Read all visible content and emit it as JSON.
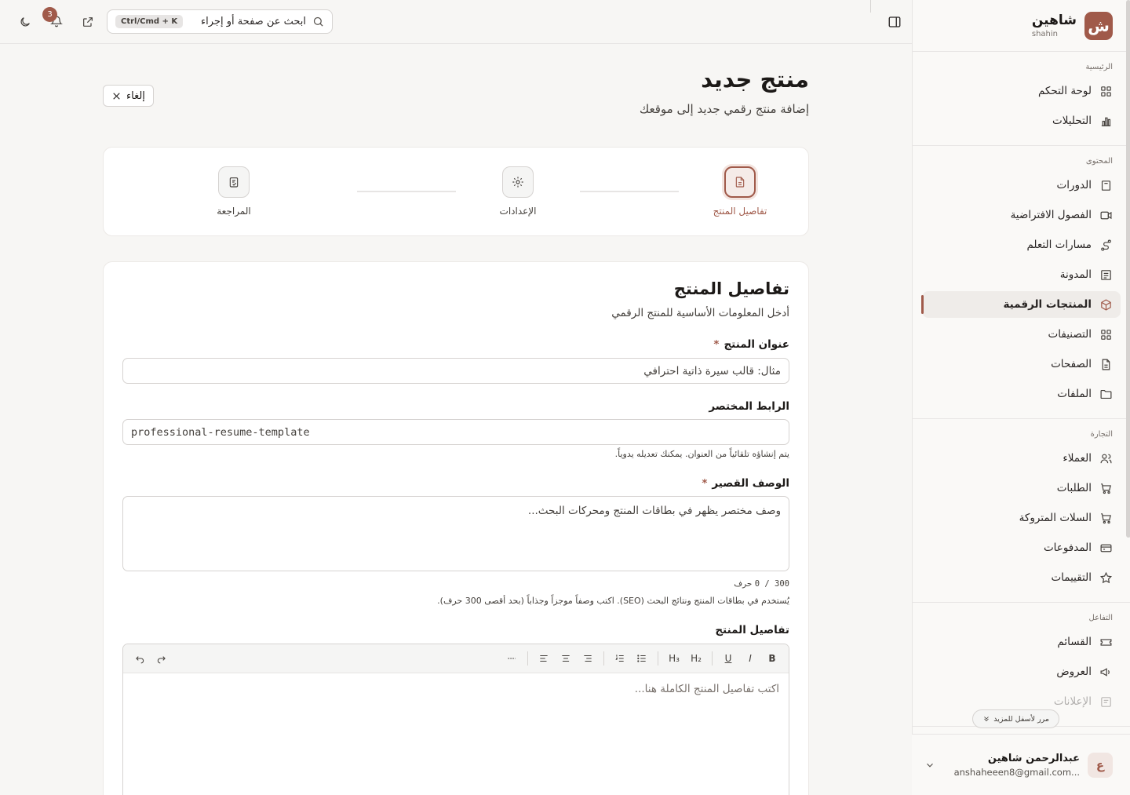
{
  "brand": {
    "logo_letter": "ش",
    "name": "شاهين",
    "sub": "shahin"
  },
  "sidebar": {
    "sections": [
      {
        "heading": "الرئيسية",
        "items": [
          {
            "label": "لوحة التحكم",
            "icon": "dashboard-icon"
          },
          {
            "label": "التحليلات",
            "icon": "chart-icon"
          }
        ]
      },
      {
        "heading": "المحتوى",
        "items": [
          {
            "label": "الدورات",
            "icon": "book-icon"
          },
          {
            "label": "الفصول الافتراضية",
            "icon": "video-icon"
          },
          {
            "label": "مسارات التعلم",
            "icon": "route-icon"
          },
          {
            "label": "المدونة",
            "icon": "newspaper-icon"
          },
          {
            "label": "المنتجات الرقمية",
            "icon": "package-icon",
            "active": true
          },
          {
            "label": "التصنيفات",
            "icon": "grid-icon"
          },
          {
            "label": "الصفحات",
            "icon": "file-icon"
          },
          {
            "label": "الملفات",
            "icon": "folder-icon"
          }
        ]
      },
      {
        "heading": "التجارة",
        "items": [
          {
            "label": "العملاء",
            "icon": "users-icon"
          },
          {
            "label": "الطلبات",
            "icon": "cart-icon"
          },
          {
            "label": "السلات المتروكة",
            "icon": "cart-abandoned-icon"
          },
          {
            "label": "المدفوعات",
            "icon": "credit-card-icon"
          },
          {
            "label": "التقييمات",
            "icon": "star-icon"
          }
        ]
      },
      {
        "heading": "التفاعل",
        "items": [
          {
            "label": "القسائم",
            "icon": "ticket-icon"
          },
          {
            "label": "العروض",
            "icon": "megaphone-icon"
          },
          {
            "label": "الإعلانات",
            "icon": "announcement-icon",
            "faded": true
          }
        ]
      }
    ],
    "scroll_hint": "مرر لأسفل للمزيد"
  },
  "user": {
    "initial": "ع",
    "name": "عبدالرحمن شاهين",
    "email": "anshaheeen8@gmail.com..."
  },
  "topbar": {
    "search_placeholder": "ابحث عن صفحة أو إجراء",
    "shortcut": "Ctrl/Cmd + K",
    "notification_count": "3"
  },
  "page": {
    "title": "منتج جديد",
    "subtitle": "إضافة منتج رقمي جديد إلى موقعك",
    "cancel_label": "إلغاء"
  },
  "steps": [
    {
      "label": "تفاصيل المنتج",
      "active": true
    },
    {
      "label": "الإعدادات"
    },
    {
      "label": "المراجعة"
    }
  ],
  "form": {
    "title": "تفاصيل المنتج",
    "subtitle": "أدخل المعلومات الأساسية للمنتج الرقمي",
    "product_title_label": "عنوان المنتج",
    "product_title_placeholder": "مثال: قالب سيرة ذاتية احترافي",
    "slug_label": "الرابط المختصر",
    "slug_value": "professional-resume-template",
    "slug_hint": "يتم إنشاؤه تلقائياً من العنوان. يمكنك تعديله يدوياً.",
    "short_desc_label": "الوصف القصير",
    "short_desc_placeholder": "وصف مختصر يظهر في بطاقات المنتج ومحركات البحث...",
    "char_counter": "0 / 300",
    "char_unit": "حرف",
    "short_desc_hint": "يُستخدم في بطاقات المنتج ونتائج البحث (SEO). اكتب وصفاً موجزاً وجذاباً (بحد أقصى 300 حرف).",
    "details_label": "تفاصيل المنتج",
    "details_placeholder": "اكتب تفاصيل المنتج الكاملة هنا...",
    "required_mark": "*"
  },
  "toolbar": {
    "bold": "B",
    "italic": "I",
    "underline": "U",
    "h2": "H₂",
    "h3": "H₃"
  },
  "colors": {
    "accent": "#a05a4a",
    "background": "#f7f6f4"
  }
}
